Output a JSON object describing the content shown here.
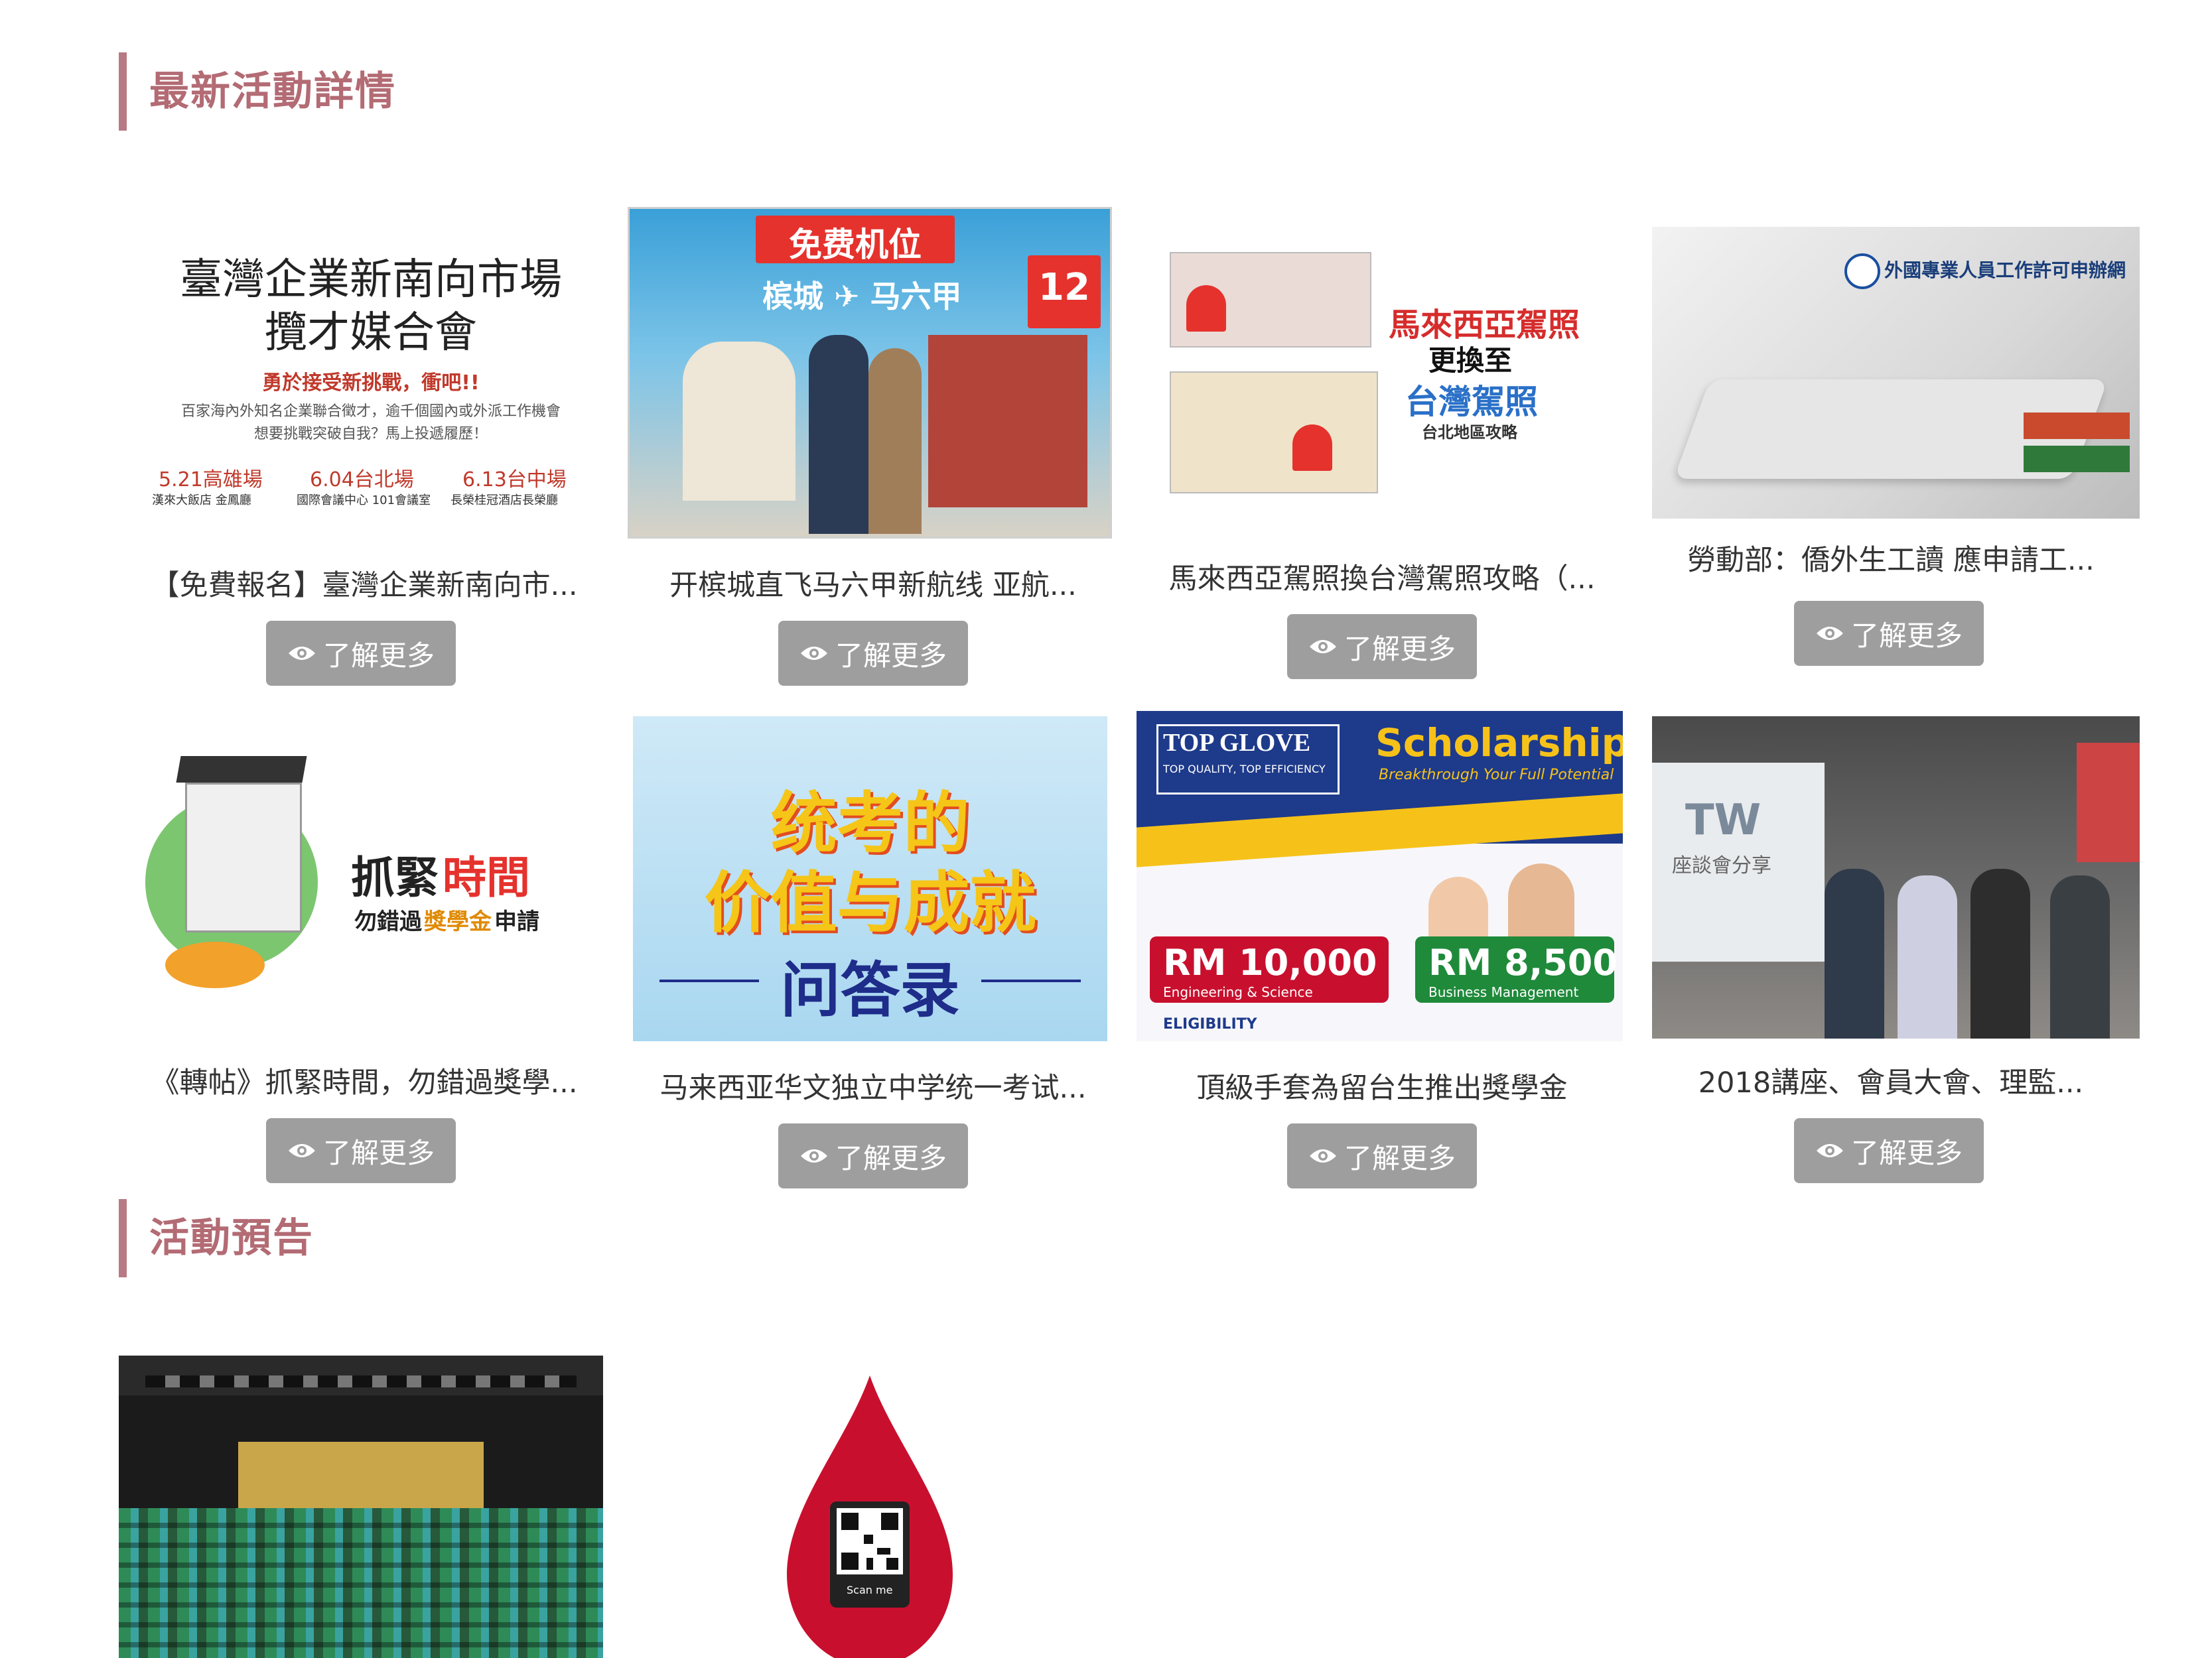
{
  "sections": {
    "latest_title": "最新活動詳情",
    "upcoming_title": "活動預告"
  },
  "more_label": "了解更多",
  "cards": [
    {
      "caption": "【免費報名】臺灣企業新南向市...",
      "image": {
        "title_line1": "臺灣企業新南向市場",
        "title_line2": "攬才媒合會",
        "slogan": "勇於接受新挑戰，衝吧!!",
        "desc_line1": "百家海內外知名企業聯合徵才，逾千個國內或外派工作機會",
        "desc_line2": "想要挑戰突破自我？馬上投遞履歷！",
        "date1": "5.21高雄場",
        "venue1": "漢來大飯店 金鳳廳",
        "date2": "6.04台北場",
        "venue2": "國際會議中心 101會議室",
        "date3": "6.13台中場",
        "venue3": "長榮桂冠酒店長榮廳"
      }
    },
    {
      "caption": "开槟城直飞马六甲新航线 亚航...",
      "image": {
        "banner": "免费机位",
        "route": "槟城 ✈ 马六甲",
        "badge": "12"
      }
    },
    {
      "caption": "馬來西亞駕照換台灣駕照攻略（...",
      "image": {
        "line1": "馬來西亞駕照",
        "line2": "更換至",
        "line3": "台灣駕照",
        "line4": "台北地區攻略"
      }
    },
    {
      "caption": "勞動部：僑外生工讀 應申請工...",
      "image": {
        "header": "外國專業人員工作許可申辦網"
      }
    },
    {
      "caption": "《轉帖》抓緊時間，勿錯過獎學...",
      "image": {
        "line1a": "抓緊",
        "line1b": "時間",
        "line2a": "勿錯過",
        "line2b": "獎學金",
        "line2c": "申請"
      }
    },
    {
      "caption": "马来西亚华文独立中学统一考试...",
      "image": {
        "line1": "统考的",
        "line2": "价值与成就",
        "line3": "问答录"
      }
    },
    {
      "caption": "頂級手套為留台生推出獎學金",
      "image": {
        "brand": "TOP GLOVE",
        "brand_sub": "TOP QUALITY, TOP EFFICIENCY",
        "heading": "Scholarships",
        "tagline": "Breakthrough Your Full Potential",
        "amount1": "RM 10,000",
        "field1": "Engineering & Science",
        "amount2": "RM 8,500",
        "field2": "Business Management",
        "eligibility": "ELIGIBILITY"
      }
    },
    {
      "caption": "2018講座、會員大會、理監...",
      "image": {
        "screen": "座談會分享",
        "logo": "TW"
      }
    }
  ],
  "upcoming": [
    {
      "image": "group-photo"
    },
    {
      "image": {
        "scan_label": "Scan me"
      }
    }
  ],
  "colors": {
    "accent": "#b36b74",
    "button": "#9e9e9e"
  }
}
